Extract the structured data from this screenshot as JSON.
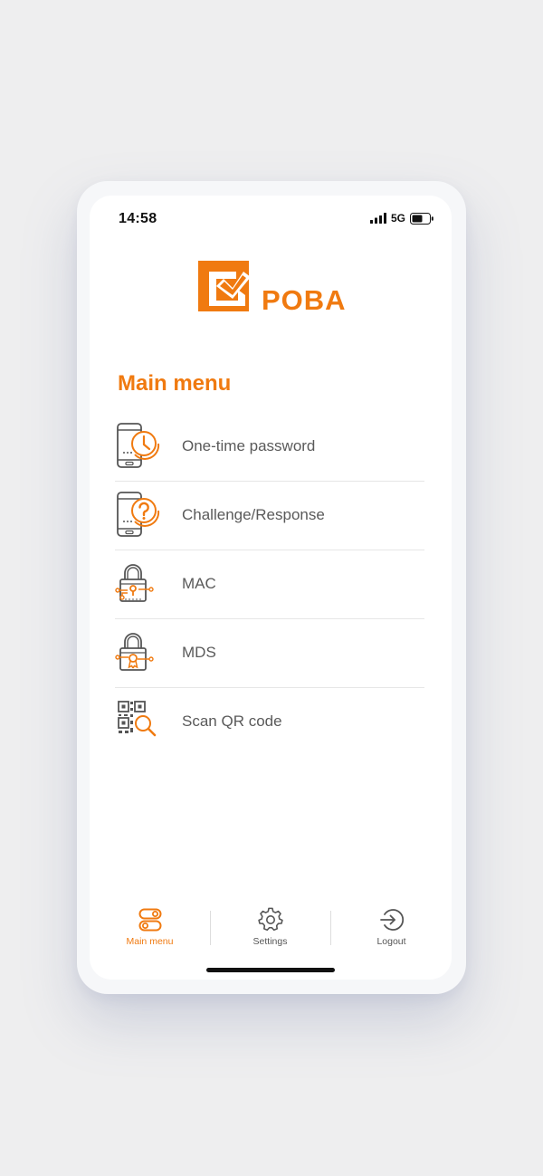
{
  "status_bar": {
    "time": "14:58",
    "network": "5G",
    "signal_icon": "cellular-signal-icon",
    "battery_icon": "battery-icon"
  },
  "brand": {
    "name": "POBA",
    "logo_icon": "poba-logo-mark",
    "color": "#f07a10"
  },
  "main": {
    "title": "Main menu",
    "items": [
      {
        "label": "One-time password",
        "icon": "phone-clock-icon"
      },
      {
        "label": "Challenge/Response",
        "icon": "phone-question-icon"
      },
      {
        "label": "MAC",
        "icon": "padlock-circuit-icon"
      },
      {
        "label": "MDS",
        "icon": "padlock-certificate-icon"
      },
      {
        "label": "Scan QR code",
        "icon": "qr-search-icon"
      }
    ]
  },
  "tabs": [
    {
      "label": "Main menu",
      "icon": "toggles-icon",
      "active": true
    },
    {
      "label": "Settings",
      "icon": "gear-icon",
      "active": false
    },
    {
      "label": "Logout",
      "icon": "logout-icon",
      "active": false
    }
  ],
  "colors": {
    "accent": "#f07a10",
    "text": "#5a5a5a",
    "icon_outline": "#555555"
  }
}
